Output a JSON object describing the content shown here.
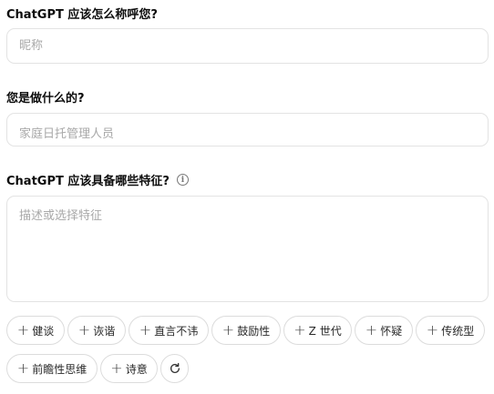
{
  "nickname": {
    "label": "ChatGPT 应该怎么称呼您?",
    "placeholder": "昵称"
  },
  "occupation": {
    "label": "您是做什么的?",
    "placeholder": "家庭日托管理人员"
  },
  "traits": {
    "label": "ChatGPT 应该具备哪些特征?",
    "info_icon": "info-icon",
    "placeholder": "描述或选择特征",
    "chips": [
      "健谈",
      "诙谐",
      "直言不讳",
      "鼓励性",
      "Z 世代",
      "怀疑",
      "传统型",
      "前瞻性思维",
      "诗意"
    ],
    "chip_icon": "plus-icon",
    "refresh_icon": "refresh-icon"
  }
}
